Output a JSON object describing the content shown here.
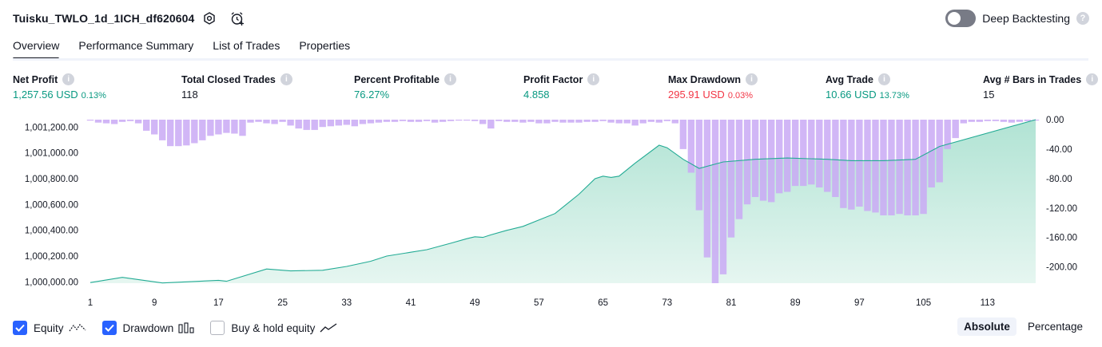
{
  "header": {
    "strategy_name": "Tuisku_TWLO_1d_1ICH_df620604",
    "settings_icon": "gear-hexagon-icon",
    "alert_icon": "alarm-clock-plus-icon",
    "deep_backtesting_label": "Deep Backtesting",
    "deep_backtesting_enabled": false,
    "help_glyph": "?"
  },
  "tabs": [
    {
      "label": "Overview",
      "active": true
    },
    {
      "label": "Performance Summary",
      "active": false
    },
    {
      "label": "List of Trades",
      "active": false
    },
    {
      "label": "Properties",
      "active": false
    }
  ],
  "metrics": {
    "net_profit": {
      "label": "Net Profit",
      "value": "1,257.56 USD",
      "pct": "0.13%"
    },
    "total_closed_trades": {
      "label": "Total Closed Trades",
      "value": "118"
    },
    "percent_profitable": {
      "label": "Percent Profitable",
      "value": "76.27%"
    },
    "profit_factor": {
      "label": "Profit Factor",
      "value": "4.858"
    },
    "max_drawdown": {
      "label": "Max Drawdown",
      "value": "295.91 USD",
      "pct": "0.03%"
    },
    "avg_trade": {
      "label": "Avg Trade",
      "value": "10.66 USD",
      "pct": "13.73%"
    },
    "avg_bars_in_trades": {
      "label": "Avg # Bars in Trades",
      "value": "15"
    }
  },
  "colors": {
    "positive": "#089981",
    "negative": "#f23645",
    "equity_line": "#22ab94",
    "equity_fill": "#c8ebe1",
    "drawdown_bar": "#c9a9f5",
    "accent": "#2962ff"
  },
  "chart_data": {
    "type": "area",
    "x_ticks": [
      "1",
      "9",
      "17",
      "25",
      "33",
      "41",
      "49",
      "57",
      "65",
      "73",
      "81",
      "89",
      "97",
      "105",
      "113"
    ],
    "x_range": [
      1,
      119
    ],
    "left_axis": {
      "ticks": [
        "1,001,200.00",
        "1,001,000.00",
        "1,000,800.00",
        "1,000,600.00",
        "1,000,400.00",
        "1,000,200.00",
        "1,000,000.00"
      ],
      "range": [
        999990,
        1001257.56
      ]
    },
    "right_axis": {
      "ticks": [
        "0.00",
        "-40.00",
        "-80.00",
        "-120.00",
        "-160.00",
        "-200.00"
      ],
      "range": [
        -222,
        0
      ]
    },
    "series": [
      {
        "name": "Equity",
        "x": [
          1,
          5,
          10,
          17,
          18,
          23,
          26,
          30,
          33,
          36,
          38,
          41,
          43,
          46,
          48,
          49,
          50,
          51,
          53,
          55,
          57,
          59,
          62,
          64,
          65,
          66,
          67,
          69,
          72,
          73,
          75,
          77,
          80,
          84,
          88,
          93,
          96,
          100,
          104,
          107,
          119
        ],
        "y": [
          999995,
          1000035,
          999992,
          1000012,
          1000005,
          1000100,
          1000085,
          1000090,
          1000120,
          1000160,
          1000200,
          1000230,
          1000250,
          1000300,
          1000335,
          1000350,
          1000345,
          1000365,
          1000400,
          1000430,
          1000480,
          1000530,
          1000680,
          1000800,
          1000820,
          1000810,
          1000820,
          1000920,
          1001060,
          1001040,
          1000950,
          1000880,
          1000930,
          1000950,
          1000960,
          1000950,
          1000940,
          1000940,
          1000950,
          1001050,
          1001257.56
        ]
      },
      {
        "name": "Drawdown",
        "values": [
          0,
          -4,
          -5,
          -6,
          -3,
          -2,
          -5,
          -15,
          -20,
          -28,
          -36,
          -36,
          -35,
          -32,
          -28,
          -22,
          -20,
          -18,
          -19,
          -22,
          -4,
          -3,
          -5,
          -6,
          -3,
          -8,
          -12,
          -14,
          -14,
          -10,
          -9,
          -8,
          -7,
          -9,
          -6,
          -5,
          -4,
          -3,
          -3,
          -2,
          -3,
          -3,
          -2,
          -4,
          -3,
          -2,
          -1,
          -1,
          -2,
          -6,
          -12,
          -2,
          -3,
          -3,
          -4,
          -3,
          -5,
          -5,
          -3,
          -4,
          -4,
          -4,
          -3,
          -3,
          -2,
          -4,
          -5,
          -5,
          -8,
          -5,
          -3,
          -4,
          -2,
          -5,
          -40,
          -72,
          -123,
          -187,
          -222,
          -210,
          -160,
          -135,
          -115,
          -105,
          -110,
          -112,
          -100,
          -98,
          -90,
          -90,
          -88,
          -92,
          -98,
          -105,
          -120,
          -122,
          -118,
          -124,
          -126,
          -130,
          -130,
          -128,
          -130,
          -130,
          -128,
          -92,
          -85,
          -40,
          -25,
          -5,
          -3,
          -3,
          -2,
          -2,
          -3,
          -4,
          -3,
          -2,
          -1
        ]
      },
      {
        "name": "Buy & hold equity",
        "visible": false
      }
    ],
    "grid": false
  },
  "legend": {
    "items": [
      {
        "label": "Equity",
        "checked": true,
        "icon": "equity-line-icon"
      },
      {
        "label": "Drawdown",
        "checked": true,
        "icon": "drawdown-bars-icon"
      },
      {
        "label": "Buy & hold equity",
        "checked": false,
        "icon": "buy-hold-line-icon"
      }
    ],
    "modes": [
      {
        "label": "Absolute",
        "active": true
      },
      {
        "label": "Percentage",
        "active": false
      }
    ]
  }
}
